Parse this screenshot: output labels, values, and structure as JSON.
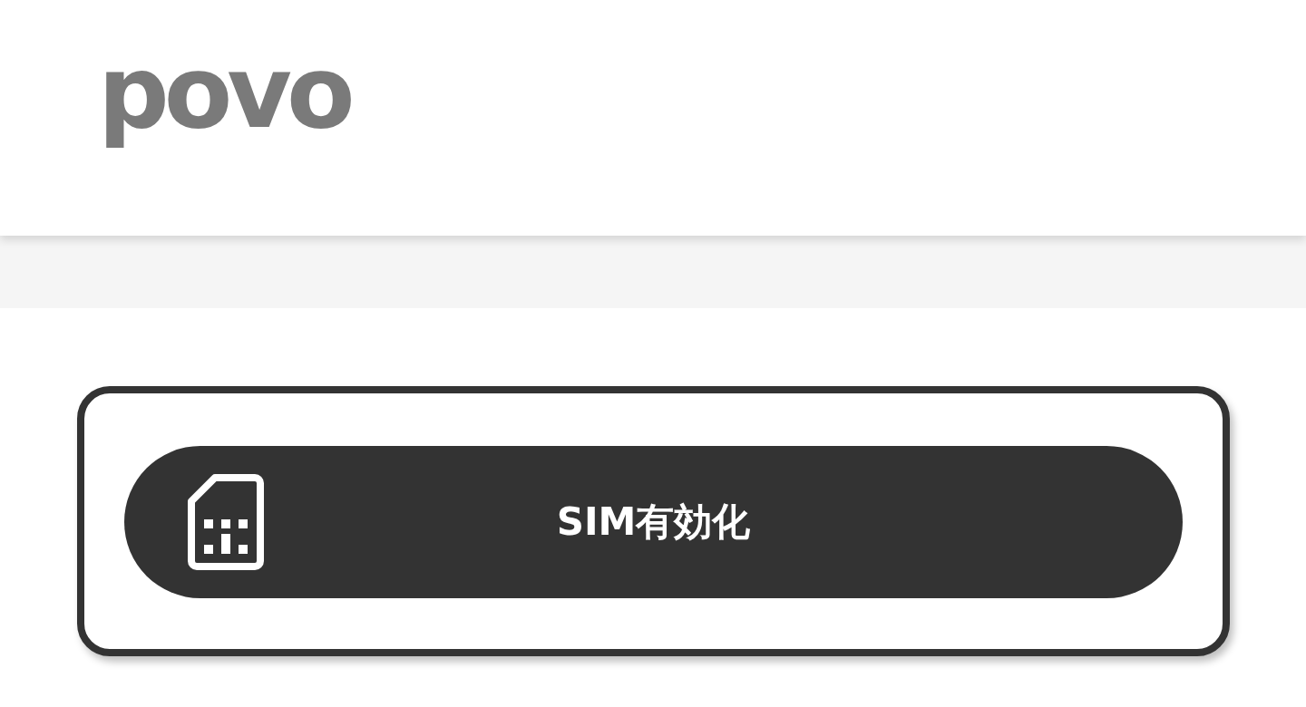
{
  "header": {
    "logo": "povo"
  },
  "action_card": {
    "button": {
      "label": "SIM有効化"
    }
  }
}
